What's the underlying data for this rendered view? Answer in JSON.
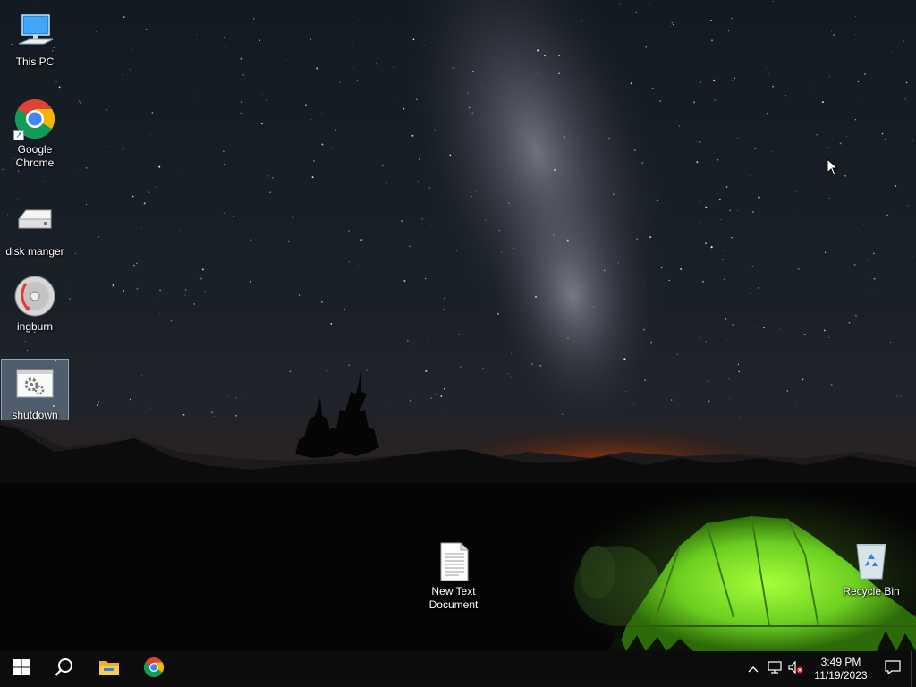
{
  "desktop": {
    "icons": [
      {
        "name": "this-pc",
        "label": "This PC"
      },
      {
        "name": "google-chrome",
        "label": "Google\nChrome"
      },
      {
        "name": "disk-manger",
        "label": "disk manger"
      },
      {
        "name": "ingburn",
        "label": "ingburn"
      },
      {
        "name": "shutdown",
        "label": "shutdown",
        "selected": true
      },
      {
        "name": "new-text-document",
        "label": "New Text\nDocument"
      },
      {
        "name": "recycle-bin",
        "label": "Recycle Bin"
      }
    ]
  },
  "taskbar": {
    "start_icon": "windows-logo-icon",
    "search_icon": "search-icon",
    "pinned": [
      {
        "name": "file-explorer",
        "icon": "folder-icon"
      },
      {
        "name": "chrome",
        "icon": "chrome-icon"
      }
    ],
    "tray": {
      "icons": [
        "chevron-up-icon",
        "network-icon",
        "volume-muted-icon"
      ],
      "time": "3:49 PM",
      "date": "11/19/2023"
    }
  },
  "colors": {
    "taskbar_bg": "#0c0c0e",
    "accent_windows": "#ffffff",
    "tent_green": "#7be02c",
    "horizon_orange": "#e25a12",
    "folder_yellow": "#e8b130"
  }
}
